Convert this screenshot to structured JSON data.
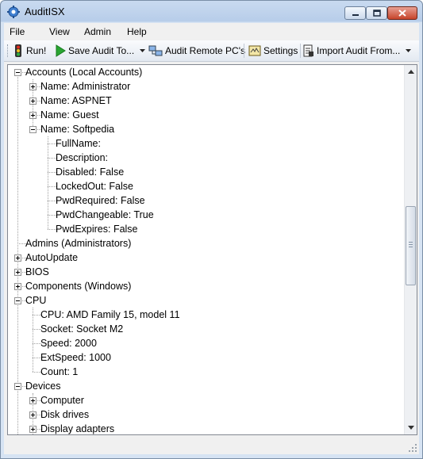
{
  "window": {
    "title": "AuditISX"
  },
  "menu": [
    {
      "key": "file",
      "label": "File"
    },
    {
      "key": "view",
      "label": "View"
    },
    {
      "key": "admin",
      "label": "Admin"
    },
    {
      "key": "help",
      "label": "Help"
    }
  ],
  "toolbar": {
    "run": "Run!",
    "save": "Save Audit To...",
    "remote": "Audit Remote PC's",
    "settings": "Settings",
    "import": "Import Audit From..."
  },
  "tree": [
    {
      "text": "Accounts (Local Accounts)",
      "level": 0,
      "exp": "minus"
    },
    {
      "text": "Name: Administrator",
      "level": 1,
      "exp": "plus"
    },
    {
      "text": "Name: ASPNET",
      "level": 1,
      "exp": "plus"
    },
    {
      "text": "Name: Guest",
      "level": 1,
      "exp": "plus"
    },
    {
      "text": "Name: Softpedia",
      "level": 1,
      "exp": "minus"
    },
    {
      "text": "FullName:",
      "level": 2,
      "exp": ""
    },
    {
      "text": "Description:",
      "level": 2,
      "exp": ""
    },
    {
      "text": "Disabled: False",
      "level": 2,
      "exp": ""
    },
    {
      "text": "LockedOut: False",
      "level": 2,
      "exp": ""
    },
    {
      "text": "PwdRequired: False",
      "level": 2,
      "exp": ""
    },
    {
      "text": "PwdChangeable: True",
      "level": 2,
      "exp": ""
    },
    {
      "text": "PwdExpires: False",
      "level": 2,
      "exp": ""
    },
    {
      "text": "Admins (Administrators)",
      "level": 0,
      "exp": ""
    },
    {
      "text": "AutoUpdate",
      "level": 0,
      "exp": "plus"
    },
    {
      "text": "BIOS",
      "level": 0,
      "exp": "plus"
    },
    {
      "text": "Components (Windows)",
      "level": 0,
      "exp": "plus"
    },
    {
      "text": "CPU",
      "level": 0,
      "exp": "minus"
    },
    {
      "text": "CPU: AMD Family 15, model 11",
      "level": 1,
      "exp": ""
    },
    {
      "text": "Socket: Socket M2",
      "level": 1,
      "exp": ""
    },
    {
      "text": "Speed: 2000",
      "level": 1,
      "exp": ""
    },
    {
      "text": "ExtSpeed: 1000",
      "level": 1,
      "exp": ""
    },
    {
      "text": "Count: 1",
      "level": 1,
      "exp": ""
    },
    {
      "text": "Devices",
      "level": 0,
      "exp": "minus"
    },
    {
      "text": "Computer",
      "level": 1,
      "exp": "plus"
    },
    {
      "text": "Disk drives",
      "level": 1,
      "exp": "plus"
    },
    {
      "text": "Display adapters",
      "level": 1,
      "exp": "plus"
    }
  ]
}
